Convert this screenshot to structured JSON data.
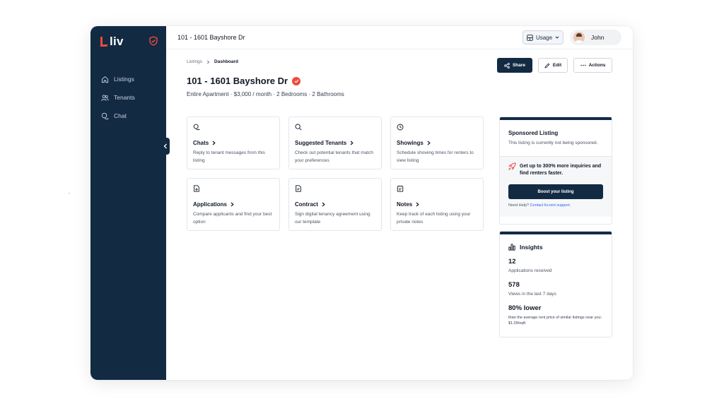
{
  "app": {
    "brand": "liv"
  },
  "sidebar": {
    "items": [
      {
        "label": "Listings",
        "icon": "home-icon"
      },
      {
        "label": "Tenants",
        "icon": "users-icon"
      },
      {
        "label": "Chat",
        "icon": "chat-icon"
      }
    ]
  },
  "topbar": {
    "title": "101 - 1601 Bayshore Dr",
    "usage_label": "Usage",
    "user_name": "John"
  },
  "breadcrumb": {
    "parent": "Listings",
    "current": "Dashboard"
  },
  "toolbar": {
    "share_label": "Share",
    "edit_label": "Edit",
    "actions_label": "Actions"
  },
  "listing": {
    "title": "101 - 1601 Bayshore Dr",
    "subtitle": "Entire Apartment · $3,000 / month · 2 Bedrooms · 2 Bathrooms"
  },
  "cards": [
    {
      "title": "Chats",
      "desc": "Reply to tenant messages from this listing",
      "icon": "chat-icon"
    },
    {
      "title": "Suggested Tenants",
      "desc": "Check out potential tenants that match your preferences",
      "icon": "search-icon"
    },
    {
      "title": "Showings",
      "desc": "Schedule showing times for renters to view listing",
      "icon": "clock-icon"
    },
    {
      "title": "Applications",
      "desc": "Compare applicants and find your best option",
      "icon": "application-icon"
    },
    {
      "title": "Contract",
      "desc": "Sign digital tenancy agreement using our template",
      "icon": "contract-icon"
    },
    {
      "title": "Notes",
      "desc": "Keep track of each listing using your private notes",
      "icon": "notes-icon"
    }
  ],
  "sponsored": {
    "title": "Sponsored Listing",
    "text": "This listing is currently not being sponsored.",
    "promo": "Get up to 300% more inquiries and find renters faster.",
    "boost_label": "Boost your listing",
    "help_prefix": "Need Help?",
    "help_link": "Contact liv.rent support."
  },
  "insights": {
    "title": "Insights",
    "stats": [
      {
        "value": "12",
        "label": "Applications received"
      },
      {
        "value": "578",
        "label": "Views in the last 7 days"
      },
      {
        "value": "80% lower",
        "label": "than the average rent price of similar listings near you: $1.09/sqft"
      }
    ]
  },
  "colors": {
    "brand_navy": "#132a43",
    "brand_red": "#ef4a3c",
    "link_blue": "#2563eb"
  }
}
